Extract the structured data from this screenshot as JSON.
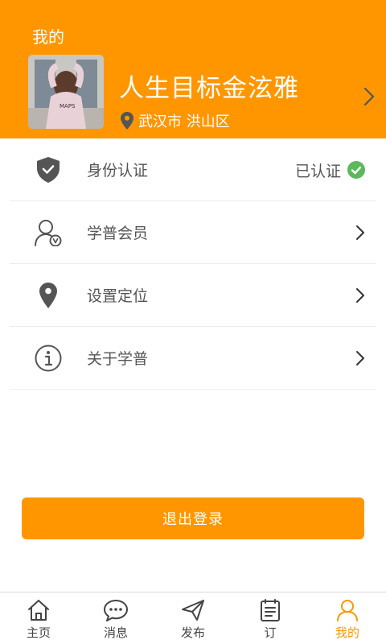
{
  "header": {
    "title": "我的",
    "profile_name": "人生目标金泫雅",
    "location": "武汉市 洪山区",
    "avatar_text": "MAPS"
  },
  "menu": {
    "items": [
      {
        "label": "身份认证",
        "status": "已认证",
        "icon": "shield-check-icon"
      },
      {
        "label": "学普会员",
        "icon": "member-icon"
      },
      {
        "label": "设置定位",
        "icon": "location-pin-icon"
      },
      {
        "label": "关于学普",
        "icon": "info-icon"
      }
    ]
  },
  "logout_label": "退出登录",
  "tabbar": {
    "tabs": [
      {
        "label": "主页",
        "icon": "home-icon"
      },
      {
        "label": "消息",
        "icon": "message-icon"
      },
      {
        "label": "发布",
        "icon": "send-icon"
      },
      {
        "label": "订",
        "icon": "clipboard-icon"
      },
      {
        "label": "我的",
        "icon": "user-icon"
      }
    ]
  },
  "colors": {
    "accent": "#FF9600",
    "verified": "#5CB85C"
  }
}
